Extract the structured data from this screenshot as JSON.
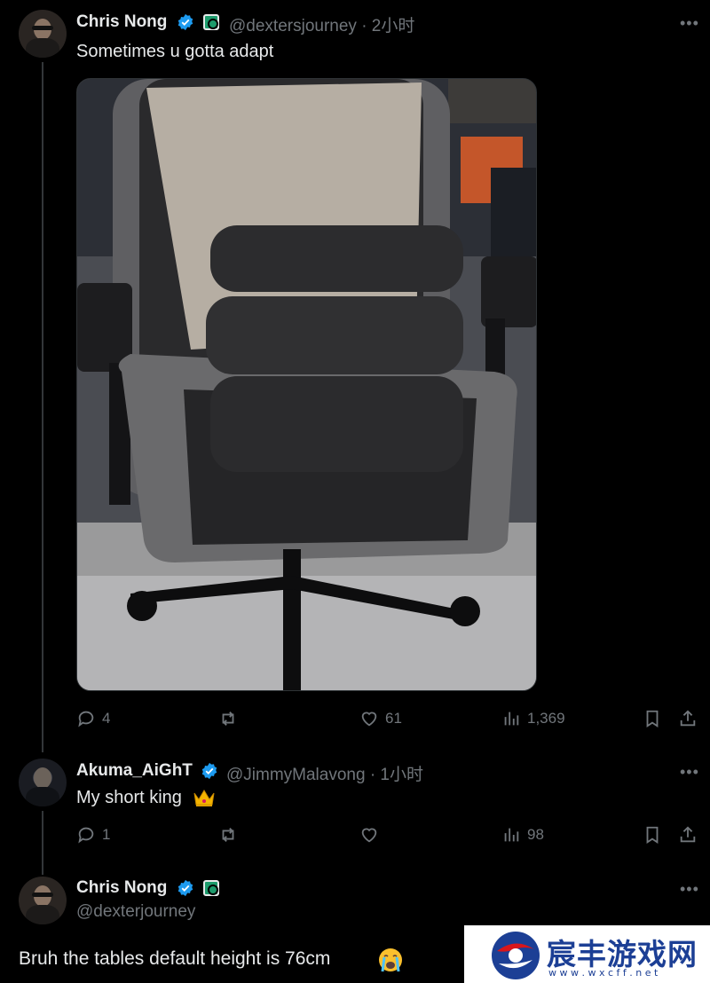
{
  "thread": {
    "posts": [
      {
        "name": "Chris Nong",
        "handle_time": "@dextersjourney · 2小时",
        "text": "Sometimes u gotta adapt",
        "replies": "4",
        "likes": "61",
        "views": "1,369"
      },
      {
        "name": "Akuma_AiGhT",
        "handle_time": "@JimmyMalavong · 1小时",
        "text": "My short king",
        "emoji": "crown-emoji",
        "replies": "1",
        "views": "98"
      },
      {
        "name": "Chris Nong",
        "handle": "@dexterjourney",
        "text": "Bruh the tables default height is 76cm",
        "emoji": "crying-face-emoji"
      }
    ]
  },
  "more_label": "•••",
  "watermark": {
    "text": "宸丰游戏网",
    "url": "w w w . w x c f f . n e t"
  },
  "colors": {
    "background": "#000000",
    "text": "#e7e9ea",
    "muted": "#71767b",
    "verified": "#1d9bf0",
    "watermark_red": "#d8161b",
    "watermark_blue": "#1c3f95"
  }
}
